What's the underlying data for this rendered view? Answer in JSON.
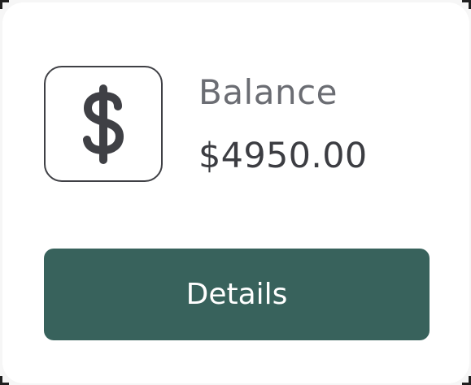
{
  "balance_card": {
    "label": "Balance",
    "amount": "$4950.00",
    "icon": "dollar-icon",
    "details_button_label": "Details"
  },
  "colors": {
    "button_bg": "#38625c",
    "icon_stroke": "#3f4045",
    "label_text": "#6b6d73",
    "amount_text": "#3c3d42"
  }
}
